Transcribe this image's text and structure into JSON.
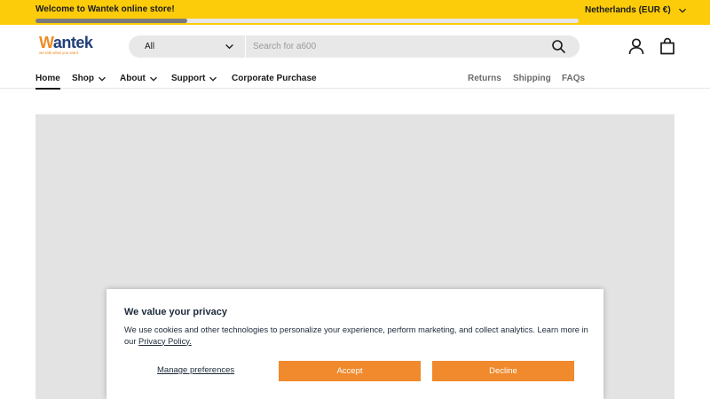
{
  "announcement": {
    "text": "Welcome to Wantek online store!",
    "scroll_fraction": 0.28
  },
  "country_selector": {
    "label": "Netherlands (EUR €)"
  },
  "brand": {
    "name_first": "W",
    "name_rest": "antek",
    "tagline": "we talk what you want",
    "colors": {
      "primary": "#1f3f7a",
      "accent": "#f08a24"
    }
  },
  "search": {
    "category": "All",
    "placeholder": "Search for a600",
    "icon": "search-icon"
  },
  "header_icons": [
    "account-icon",
    "bag-icon"
  ],
  "nav": {
    "primary": [
      {
        "label": "Home",
        "active": true,
        "dropdown": false
      },
      {
        "label": "Shop",
        "active": false,
        "dropdown": true
      },
      {
        "label": "About",
        "active": false,
        "dropdown": true
      },
      {
        "label": "Support",
        "active": false,
        "dropdown": true
      },
      {
        "label": "Corporate Purchase",
        "active": false,
        "dropdown": false
      }
    ],
    "secondary": [
      {
        "label": "Returns"
      },
      {
        "label": "Shipping"
      },
      {
        "label": "FAQs"
      }
    ]
  },
  "cookie": {
    "title": "We value your privacy",
    "text": "We use cookies and other technologies to personalize your experience, perform marketing, and collect analytics. Learn more in our",
    "link": "Privacy Policy.",
    "manage": "Manage preferences",
    "accept": "Accept",
    "decline": "Decline",
    "button_color": "#f08a2c"
  },
  "colors": {
    "announcement_bg": "#fccc0a",
    "hero_placeholder": "#e3e3e3"
  }
}
